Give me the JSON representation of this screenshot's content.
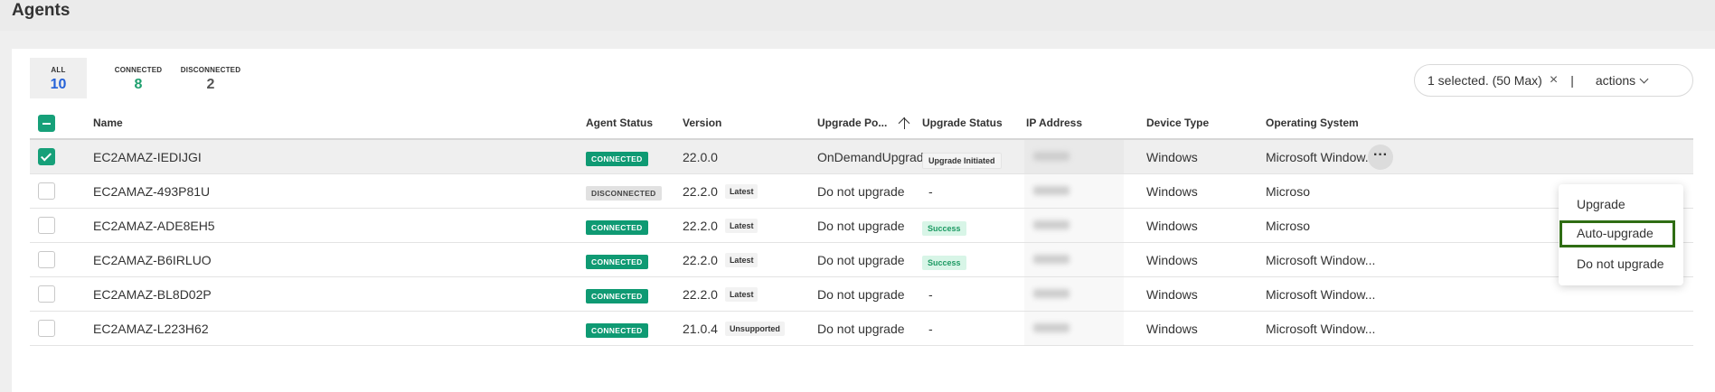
{
  "page": {
    "title": "Agents"
  },
  "stats": [
    {
      "label": "ALL",
      "value": "10"
    },
    {
      "label": "CONNECTED",
      "value": "8"
    },
    {
      "label": "DISCONNECTED",
      "value": "2"
    }
  ],
  "selection": {
    "text": "1 selected. (50 Max)",
    "clear_icon": "×",
    "divider": "|",
    "actions_label": "actions"
  },
  "columns": {
    "name": "Name",
    "agent_status": "Agent Status",
    "version": "Version",
    "upgrade_policy": "Upgrade Po...",
    "upgrade_status": "Upgrade Status",
    "ip_address": "IP Address",
    "device_type": "Device Type",
    "os": "Operating System"
  },
  "rows": [
    {
      "name": "EC2AMAZ-IEDIJGI",
      "status": "CONNECTED",
      "version": "22.0.0",
      "version_tag": "",
      "policy": "OnDemandUpgrade",
      "upgrade_status": "Upgrade Initiated",
      "device": "Windows",
      "os": "Microsoft Window..."
    },
    {
      "name": "EC2AMAZ-493P81U",
      "status": "DISCONNECTED",
      "version": "22.2.0",
      "version_tag": "Latest",
      "policy": "Do not upgrade",
      "upgrade_status": "-",
      "device": "Windows",
      "os": "Microso"
    },
    {
      "name": "EC2AMAZ-ADE8EH5",
      "status": "CONNECTED",
      "version": "22.2.0",
      "version_tag": "Latest",
      "policy": "Do not upgrade",
      "upgrade_status": "Success",
      "device": "Windows",
      "os": "Microso"
    },
    {
      "name": "EC2AMAZ-B6IRLUO",
      "status": "CONNECTED",
      "version": "22.2.0",
      "version_tag": "Latest",
      "policy": "Do not upgrade",
      "upgrade_status": "Success",
      "device": "Windows",
      "os": "Microsoft Window..."
    },
    {
      "name": "EC2AMAZ-BL8D02P",
      "status": "CONNECTED",
      "version": "22.2.0",
      "version_tag": "Latest",
      "policy": "Do not upgrade",
      "upgrade_status": "-",
      "device": "Windows",
      "os": "Microsoft Window..."
    },
    {
      "name": "EC2AMAZ-L223H62",
      "status": "CONNECTED",
      "version": "21.0.4",
      "version_tag": "Unsupported",
      "policy": "Do not upgrade",
      "upgrade_status": "-",
      "device": "Windows",
      "os": "Microsoft Window..."
    }
  ],
  "row_actions": {
    "more_icon": "···"
  },
  "menu": {
    "items": [
      "Upgrade",
      "Auto-upgrade",
      "Do not upgrade"
    ]
  },
  "colors": {
    "connected": "#0f9a73",
    "accent_blue": "#2562d8",
    "focus_outline": "#2f6d14"
  }
}
